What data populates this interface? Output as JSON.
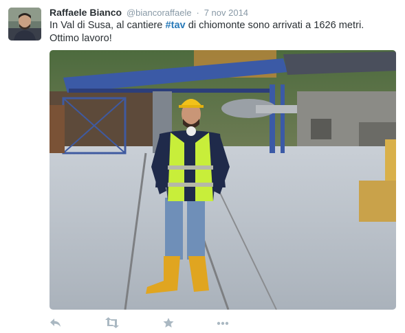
{
  "tweet": {
    "display_name": "Raffaele Bianco",
    "handle": "@biancoraffaele",
    "separator": "·",
    "timestamp": "7 nov 2014",
    "text_before": "In Val di Susa, al cantiere ",
    "hashtag": "#tav",
    "text_after": " di chiomonte sono arrivati a 1626 metri. Ottimo lavoro!"
  },
  "actions": [
    "reply-icon",
    "retweet-icon",
    "favorite-icon",
    "more-icon"
  ],
  "colors": {
    "name": "#292f33",
    "meta": "#8899a6",
    "hashtag": "#2b7bb9",
    "action_icons": "#aab8c2"
  }
}
